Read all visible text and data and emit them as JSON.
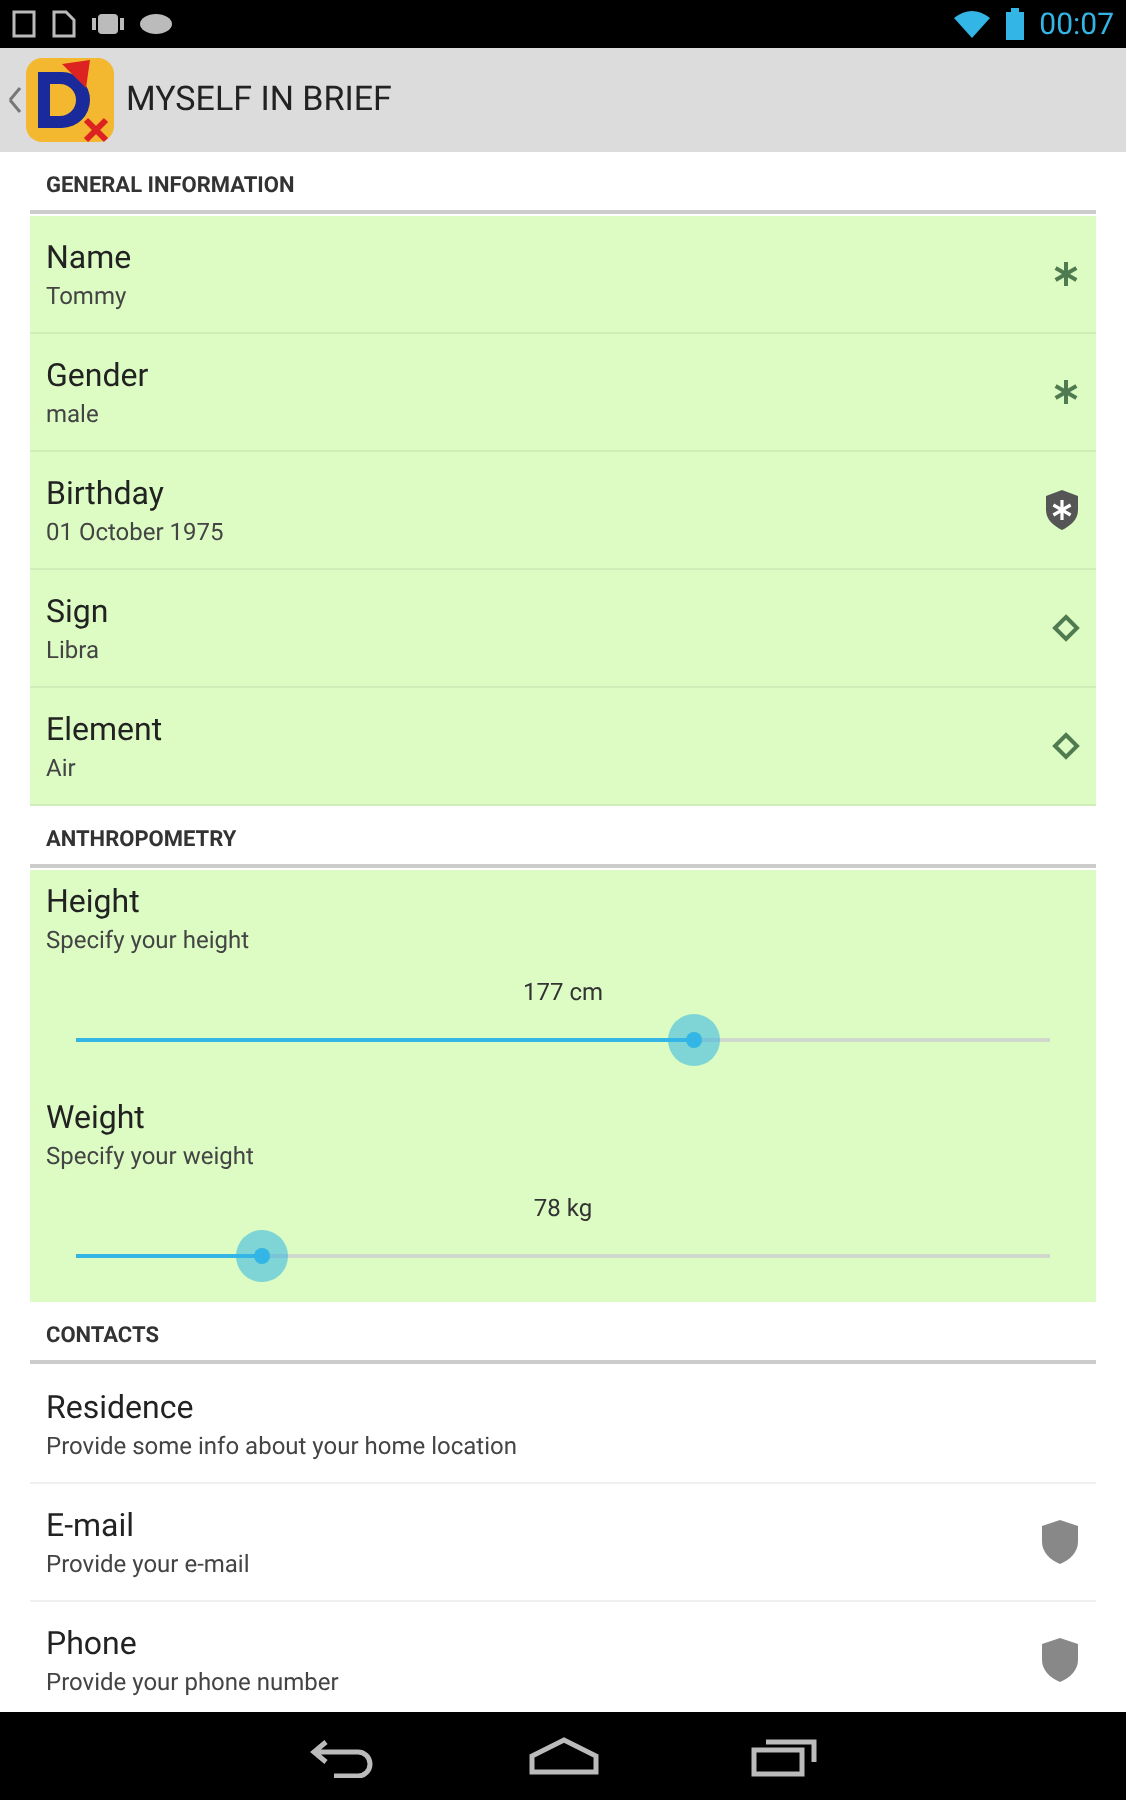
{
  "status_bar": {
    "time": "00:07"
  },
  "action_bar": {
    "title": "MYSELF IN BRIEF"
  },
  "sections": [
    {
      "title": "GENERAL INFORMATION",
      "highlighted": true,
      "rows": [
        {
          "kind": "required",
          "title": "Name",
          "summary": "Tommy"
        },
        {
          "kind": "required",
          "title": "Gender",
          "summary": "male"
        },
        {
          "kind": "protected",
          "title": "Birthday",
          "summary": "01 October 1975"
        },
        {
          "kind": "derived",
          "title": "Sign",
          "summary": "Libra"
        },
        {
          "kind": "derived",
          "title": "Element",
          "summary": "Air"
        }
      ]
    },
    {
      "title": "ANTHROPOMETRY",
      "highlighted": true,
      "rows": [
        {
          "kind": "slider",
          "title": "Height",
          "summary": "Specify your height",
          "reading": "177 cm",
          "level": 0.635
        },
        {
          "kind": "slider",
          "title": "Weight",
          "summary": "Specify your weight",
          "reading": "78 kg",
          "level": 0.19
        }
      ]
    },
    {
      "title": "CONTACTS",
      "highlighted": false,
      "rows": [
        {
          "kind": "plain",
          "title": "Residence",
          "summary": "Provide some info about your home location"
        },
        {
          "kind": "private",
          "title": "E-mail",
          "summary": "Provide your e-mail"
        },
        {
          "kind": "private",
          "title": "Phone",
          "summary": "Provide your phone number"
        }
      ]
    }
  ]
}
